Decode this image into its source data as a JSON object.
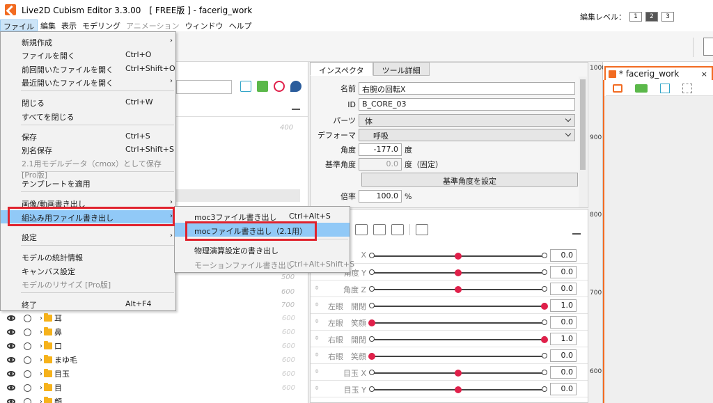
{
  "window": {
    "title": "Live2D Cubism Editor 3.3.00　[ FREE版 ] - facerig_work"
  },
  "menubar": [
    {
      "label": "ファイル",
      "active": true,
      "dim": false
    },
    {
      "label": "編集",
      "active": false,
      "dim": false
    },
    {
      "label": "表示",
      "active": false,
      "dim": false
    },
    {
      "label": "モデリング",
      "active": false,
      "dim": false
    },
    {
      "label": "アニメーション",
      "active": false,
      "dim": true
    },
    {
      "label": "ウィンドウ",
      "active": false,
      "dim": false
    },
    {
      "label": "ヘルプ",
      "active": false,
      "dim": false
    }
  ],
  "toolbar": {
    "edit_level_label": "編集レベル：",
    "levels": [
      "1",
      "2",
      "3"
    ],
    "selected_level": "2"
  },
  "file_menu": {
    "items": [
      {
        "label": "新規作成",
        "shortcut": "",
        "arrow": true,
        "disabled": false
      },
      {
        "label": "ファイルを開く",
        "shortcut": "Ctrl+O",
        "arrow": false,
        "disabled": false
      },
      {
        "label": "前回開いたファイルを開く",
        "shortcut": "Ctrl+Shift+O",
        "arrow": false,
        "disabled": false
      },
      {
        "label": "最近開いたファイルを開く",
        "shortcut": "",
        "arrow": true,
        "disabled": false
      },
      {
        "label": "閉じる",
        "shortcut": "Ctrl+W",
        "arrow": false,
        "disabled": false
      },
      {
        "label": "すべてを閉じる",
        "shortcut": "",
        "arrow": false,
        "disabled": false
      },
      {
        "label": "保存",
        "shortcut": "Ctrl+S",
        "arrow": false,
        "disabled": false
      },
      {
        "label": "別名保存",
        "shortcut": "Ctrl+Shift+S",
        "arrow": false,
        "disabled": false
      },
      {
        "label": "2.1用モデルデータ（cmox）として保存 [Pro版]",
        "shortcut": "",
        "arrow": false,
        "disabled": true
      },
      {
        "label": "テンプレートを適用",
        "shortcut": "",
        "arrow": false,
        "disabled": false
      },
      {
        "label": "画像/動画書き出し",
        "shortcut": "",
        "arrow": true,
        "disabled": false
      },
      {
        "label": "組込み用ファイル書き出し",
        "shortcut": "",
        "arrow": true,
        "disabled": false,
        "highlighted": true
      },
      {
        "label": "設定",
        "shortcut": "",
        "arrow": true,
        "disabled": false
      },
      {
        "label": "モデルの統計情報",
        "shortcut": "",
        "arrow": false,
        "disabled": false
      },
      {
        "label": "キャンバス設定",
        "shortcut": "",
        "arrow": false,
        "disabled": false
      },
      {
        "label": "モデルのリサイズ [Pro版]",
        "shortcut": "",
        "arrow": false,
        "disabled": true
      },
      {
        "label": "終了",
        "shortcut": "Alt+F4",
        "arrow": false,
        "disabled": false
      }
    ]
  },
  "export_submenu": {
    "items": [
      {
        "label": "moc3ファイル書き出し",
        "shortcut": "Ctrl+Alt+S",
        "disabled": false
      },
      {
        "label": "mocファイル書き出し（2.1用）",
        "shortcut": "",
        "disabled": false,
        "highlighted": true
      },
      {
        "label": "物理演算設定の書き出し",
        "shortcut": "",
        "disabled": false
      },
      {
        "label": "モーションファイル書き出し",
        "shortcut": "Ctrl+Alt+Shift+S",
        "disabled": true
      }
    ]
  },
  "left_panel": {
    "top_number": "400",
    "numbers": [
      "500",
      "600",
      "700"
    ],
    "tree": [
      {
        "label": "耳",
        "num": "600"
      },
      {
        "label": "鼻",
        "num": "600"
      },
      {
        "label": "口",
        "num": "600"
      },
      {
        "label": "まゆ毛",
        "num": "600"
      },
      {
        "label": "目玉",
        "num": "600"
      },
      {
        "label": "目",
        "num": "600"
      },
      {
        "label": "顔",
        "num": ""
      }
    ]
  },
  "inspector": {
    "tabs": [
      "インスペクタ",
      "ツール詳細"
    ],
    "name_label": "名前",
    "name_value": "右腕の回転X",
    "id_label": "ID",
    "id_value": "B_CORE_03",
    "parts_label": "パーツ",
    "parts_value": "体",
    "deformer_label": "デフォーマ",
    "deformer_value": "呼吸",
    "angle_label": "角度",
    "angle_value": "-177.0",
    "angle_unit": "度",
    "base_angle_label": "基準角度",
    "base_angle_value": "0.0",
    "base_angle_unit": "度（固定）",
    "set_base_button": "基準角度を設定",
    "scale_label": "倍率",
    "scale_value": "100.0",
    "scale_unit": "%"
  },
  "parameters": [
    {
      "name": "X",
      "value": "0.0",
      "pos": 0.5,
      "dim": false
    },
    {
      "name": "角度 Y",
      "value": "0.0",
      "pos": 0.5,
      "dim": false
    },
    {
      "name": "角度 Z",
      "value": "0.0",
      "pos": 0.5,
      "dim": false
    },
    {
      "name": "左眼　開閉",
      "value": "1.0",
      "pos": 1.0,
      "dim": false
    },
    {
      "name": "左眼　笑顔",
      "value": "0.0",
      "pos": 0.0,
      "dim": false
    },
    {
      "name": "右眼　開閉",
      "value": "1.0",
      "pos": 1.0,
      "dim": false
    },
    {
      "name": "右眼　笑顔",
      "value": "0.0",
      "pos": 0.0,
      "dim": false
    },
    {
      "name": "目玉 X",
      "value": "0.0",
      "pos": 0.5,
      "dim": false
    },
    {
      "name": "目玉 Y",
      "value": "0.0",
      "pos": 0.5,
      "dim": false
    }
  ],
  "canvas": {
    "tab_label": "* facerig_work",
    "close": "×",
    "ruler": [
      "1000",
      "900",
      "800",
      "700",
      "600"
    ]
  },
  "colors": {
    "accent": "#f26b21",
    "highlight": "#91c9f7",
    "annotation": "#e0232e",
    "knob": "#e0204a"
  }
}
